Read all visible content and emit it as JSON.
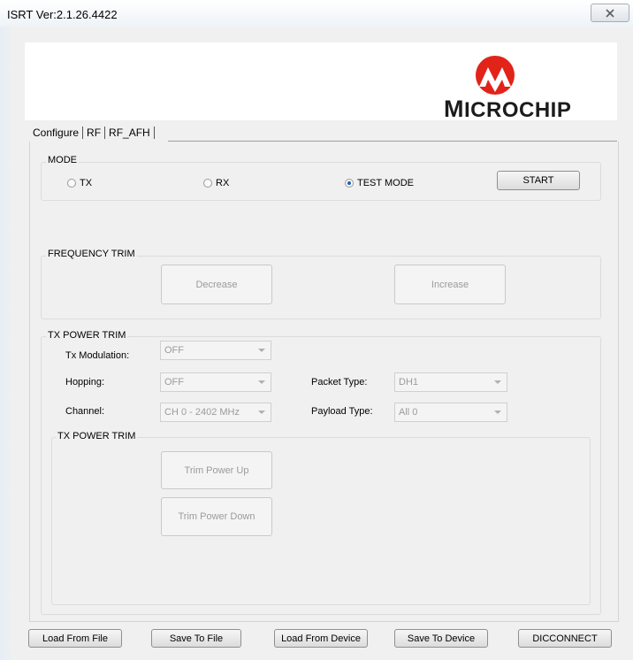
{
  "window": {
    "title": "ISRT Ver:2.1.26.4422"
  },
  "logo": {
    "text_big": "M",
    "text_rest": "ICROCHIP"
  },
  "tabs": [
    {
      "label": "Configure"
    },
    {
      "label": "RF"
    },
    {
      "label": "RF_AFH"
    }
  ],
  "mode": {
    "group_label": "MODE",
    "options": [
      {
        "label": "TX",
        "selected": false
      },
      {
        "label": "RX",
        "selected": false
      },
      {
        "label": "TEST MODE",
        "selected": true
      }
    ],
    "start_label": "START"
  },
  "frequency_trim": {
    "group_label": "FREQUENCY TRIM",
    "decrease_label": "Decrease",
    "increase_label": "Increase"
  },
  "tx_power_trim": {
    "group_label": "TX POWER TRIM",
    "tx_modulation": {
      "label": "Tx Modulation:",
      "value": "OFF"
    },
    "hopping": {
      "label": "Hopping:",
      "value": "OFF"
    },
    "channel": {
      "label": "Channel:",
      "value": "CH 0 - 2402 MHz"
    },
    "packet_type": {
      "label": "Packet Type:",
      "value": "DH1"
    },
    "payload_type": {
      "label": "Payload Type:",
      "value": "All 0"
    },
    "inner": {
      "group_label": "TX POWER TRIM",
      "trim_up_label": "Trim Power Up",
      "trim_down_label": "Trim Power Down"
    }
  },
  "footer": {
    "load_from_file": "Load From File",
    "save_to_file": "Save To File",
    "load_from_device": "Load From Device",
    "save_to_device": "Save To Device",
    "disconnect": "DICCONNECT"
  },
  "colors": {
    "logo_red": "#e2231a",
    "radio_selected": "#1f5fb9"
  }
}
